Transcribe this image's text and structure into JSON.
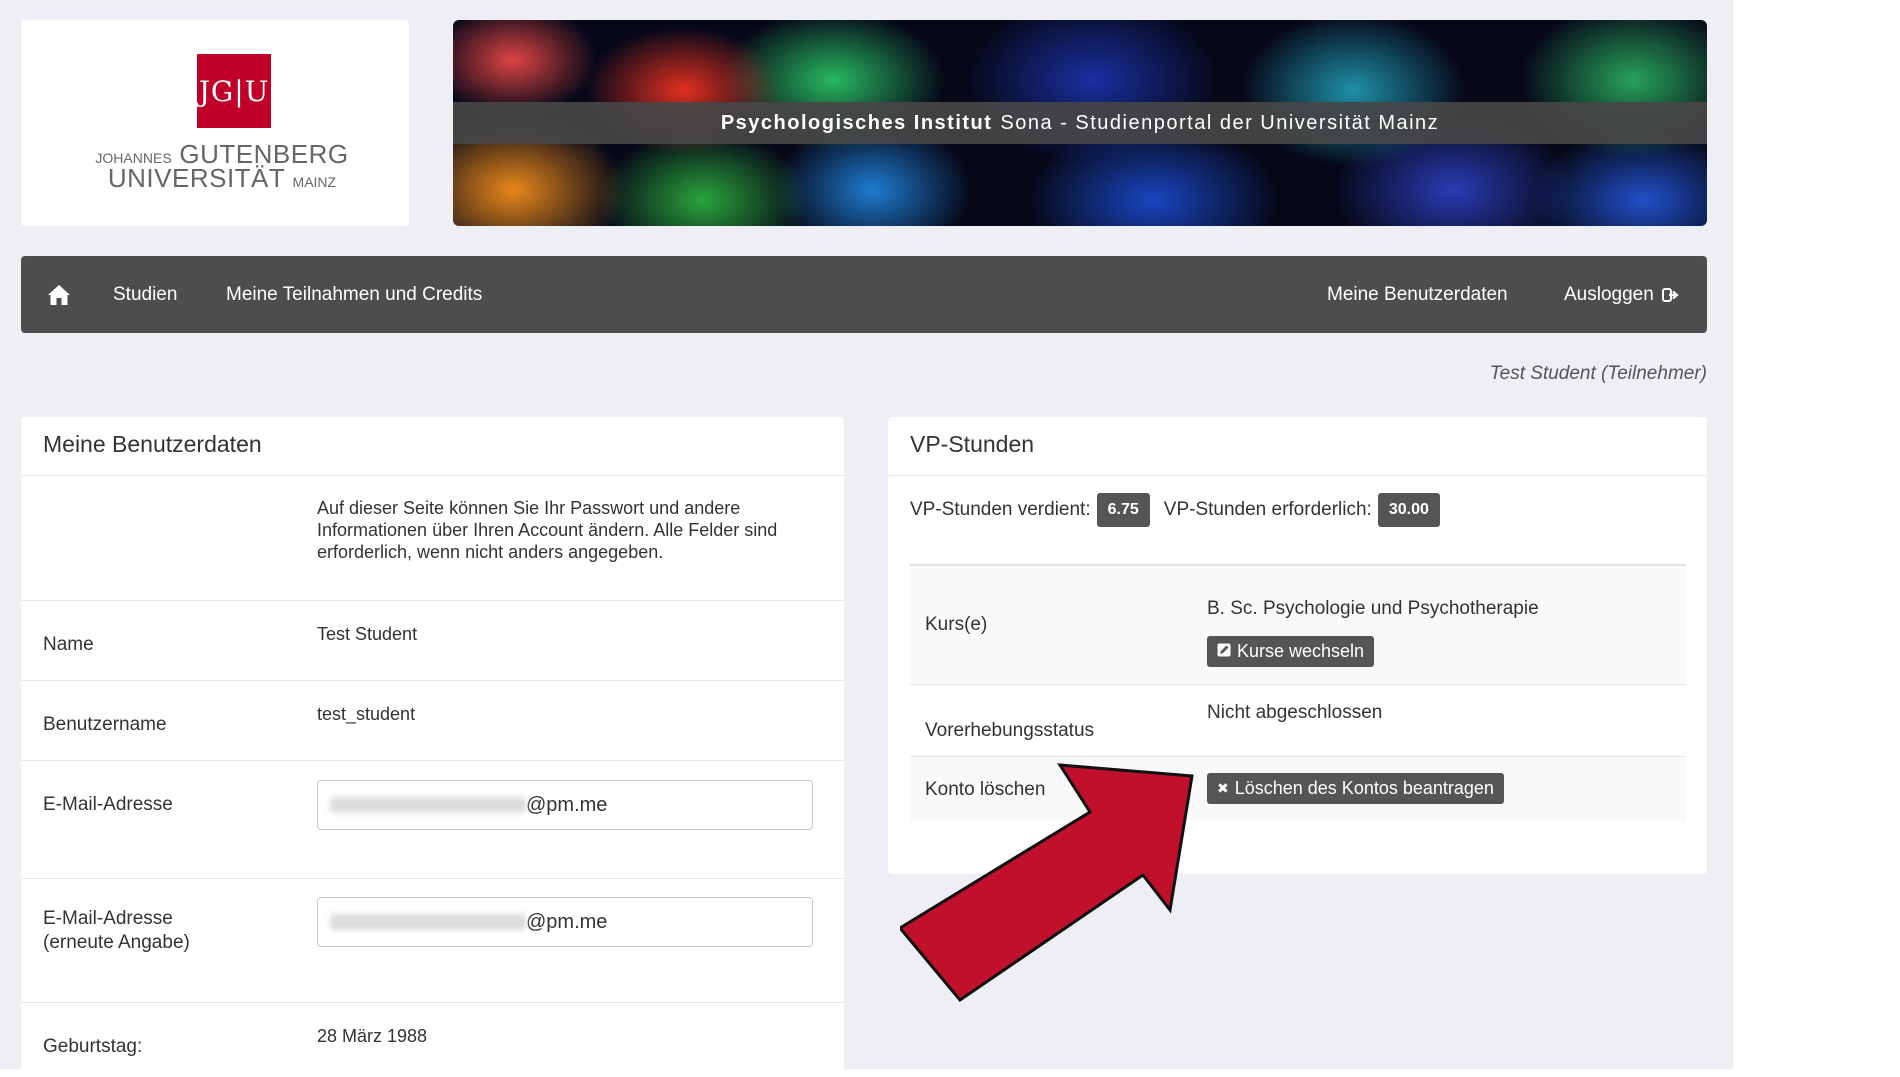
{
  "logo": {
    "square_text": "JG|U",
    "line1_prefix": "JOHANNES",
    "line1_main": "GUTENBERG",
    "line2_main": "UNIVERSITÄT",
    "line2_suffix": "MAINZ"
  },
  "banner": {
    "title_bold": "Psychologisches Institut",
    "title_rest": "Sona - Studienportal der Universität Mainz"
  },
  "nav": {
    "home_icon": "home-icon",
    "studien": "Studien",
    "teilnahmen": "Meine Teilnahmen und Credits",
    "benutzerdaten": "Meine Benutzerdaten",
    "ausloggen": "Ausloggen",
    "logout_icon": "sign-out-icon"
  },
  "user_label": "Test Student (Teilnehmer)",
  "left_card": {
    "title": "Meine Benutzerdaten",
    "intro": "Auf dieser Seite können Sie Ihr Passwort und andere Informationen über Ihren Account ändern. Alle Felder sind erforderlich, wenn nicht anders angegeben.",
    "name_label": "Name",
    "name_value": "Test Student",
    "username_label": "Benutzername",
    "username_value": "test_student",
    "email_label": "E-Mail-Adresse",
    "email_value_suffix": "@pm.me",
    "email_repeat_label_1": "E-Mail-Adresse",
    "email_repeat_label_2": "(erneute Angabe)",
    "email_repeat_value_suffix": "@pm.me",
    "birthday_label": "Geburtstag:",
    "birthday_value": "28 März 1988"
  },
  "right_card": {
    "title": "VP-Stunden",
    "earned_label": "VP-Stunden verdient:",
    "earned_value": "6.75",
    "required_label": "VP-Stunden erforderlich:",
    "required_value": "30.00",
    "kurs_label": "Kurs(e)",
    "kurs_value": "B. Sc. Psychologie und Psychotherapie",
    "kurs_button": "Kurse wechseln",
    "status_label": "Vorerhebungsstatus",
    "status_value": "Nicht abgeschlossen",
    "delete_label": "Konto löschen",
    "delete_button": "Löschen des Kontos beantragen"
  },
  "colors": {
    "navbar": "#4d4d4d",
    "jgu_red": "#c1002a",
    "annotation_arrow": "#c0102c"
  }
}
